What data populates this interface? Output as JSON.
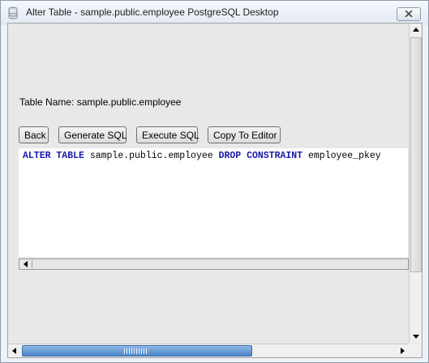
{
  "window": {
    "title": "Alter Table - sample.public.employee PostgreSQL Desktop"
  },
  "form": {
    "table_name": "Table Name: sample.public.employee"
  },
  "toolbar": {
    "back_label": "Back",
    "generate_label": "Generate SQL",
    "execute_label": "Execute SQL",
    "copy_label": "Copy To Editor"
  },
  "sql": {
    "kw1": "ALTER TABLE",
    "t1": " sample.public.employee ",
    "kw2": "DROP CONSTRAINT",
    "t2": " employee_pkey"
  },
  "colors": {
    "keyword": "#1a1aa6",
    "scroll_thumb": "#4c86c9"
  }
}
